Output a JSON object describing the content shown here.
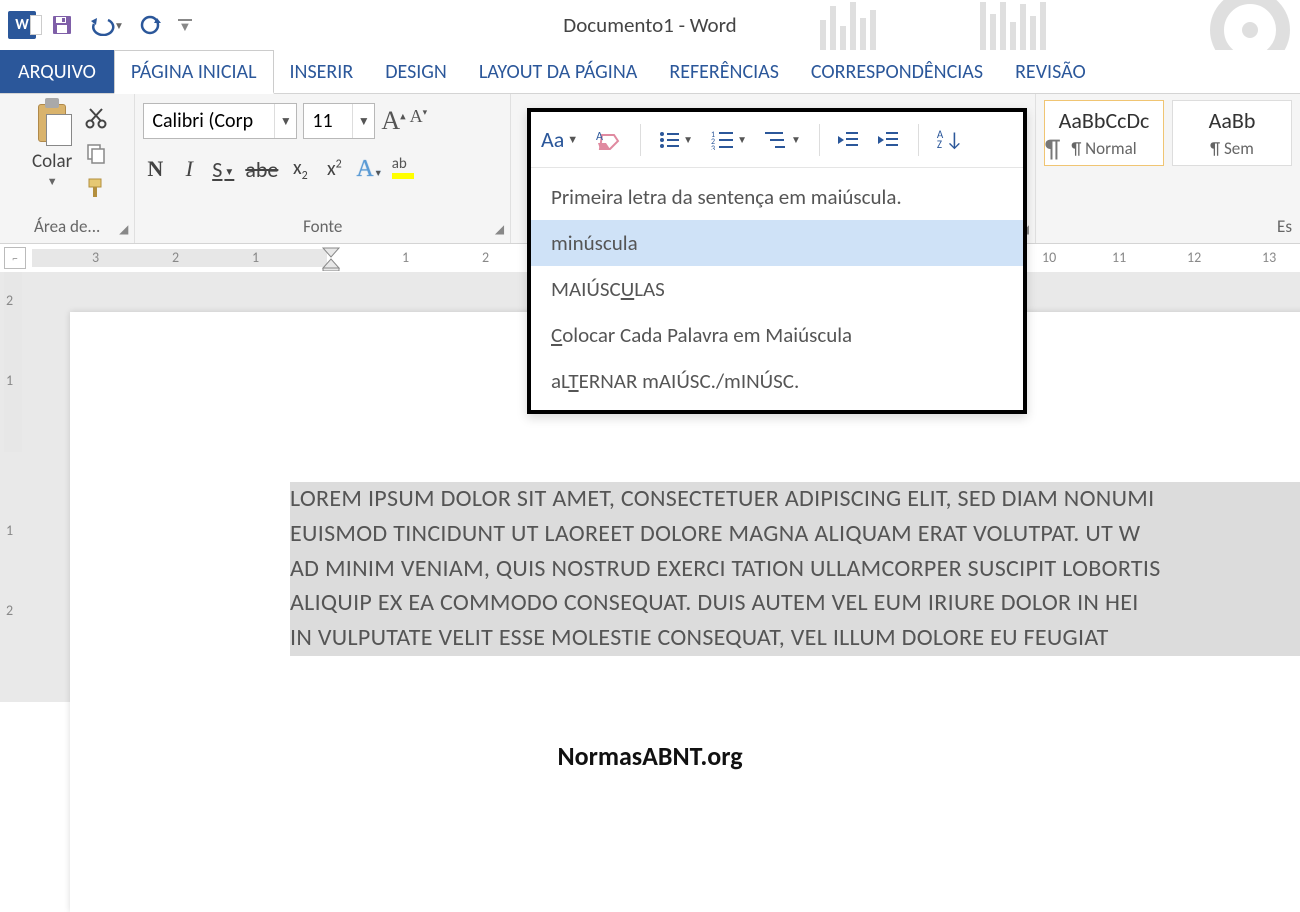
{
  "title": "Documento1 - Word",
  "qat": {
    "undo_tip": "Desfazer",
    "redo_tip": "Refazer",
    "save_tip": "Salvar"
  },
  "tabs": {
    "file": "ARQUIVO",
    "home": "PÁGINA INICIAL",
    "insert": "INSERIR",
    "design": "DESIGN",
    "layout": "LAYOUT DA PÁGINA",
    "references": "REFERÊNCIAS",
    "mailings": "CORRESPONDÊNCIAS",
    "review": "REVISÃO"
  },
  "ribbon": {
    "clipboard": {
      "paste": "Colar",
      "group": "Área de..."
    },
    "font": {
      "name": "Calibri (Corp",
      "size": "11",
      "group": "Fonte"
    },
    "styles": {
      "normal_sample": "AaBbCcDc",
      "normal_name": "¶ Normal",
      "noSpacing_sample": "AaBb",
      "noSpacing_name": "¶ Sem",
      "group": "Es"
    }
  },
  "changeCase": {
    "button": "Aa",
    "items": {
      "sentence": "Primeira letra da sentença em maiúscula.",
      "lower": "minúscula",
      "upper1": "MAIÚSC",
      "upper2": "LAS",
      "capitalize1": "C",
      "capitalize2": "olocar Cada Palavra em Maiúscula",
      "toggle1": "aL",
      "toggle2": "ERNAR mAIÚSC./mINÚSC."
    }
  },
  "ruler": {
    "nums_left": [
      "3",
      "2",
      "1"
    ],
    "nums_right": [
      "1",
      "2",
      "10",
      "11",
      "12",
      "13"
    ]
  },
  "vruler": {
    "nums": [
      "2",
      "1",
      "1",
      "2"
    ]
  },
  "document": {
    "line1": "LOREM IPSUM DOLOR SIT AMET, CONSECTETUER ADIPISCING ELIT, SED DIAM NONUMI",
    "line2": "EUISMOD TINCIDUNT UT LAOREET DOLORE MAGNA ALIQUAM ERAT VOLUTPAT. UT W",
    "line3": "AD MINIM VENIAM, QUIS NOSTRUD EXERCI TATION ULLAMCORPER SUSCIPIT LOBORTIS",
    "line4": "ALIQUIP EX EA COMMODO CONSEQUAT. DUIS AUTEM VEL EUM IRIURE DOLOR IN HEI",
    "line5": "IN VULPUTATE VELIT ESSE MOLESTIE CONSEQUAT, VEL ILLUM DOLORE EU FEUGIAT"
  },
  "watermark": "NormasABNT.org"
}
